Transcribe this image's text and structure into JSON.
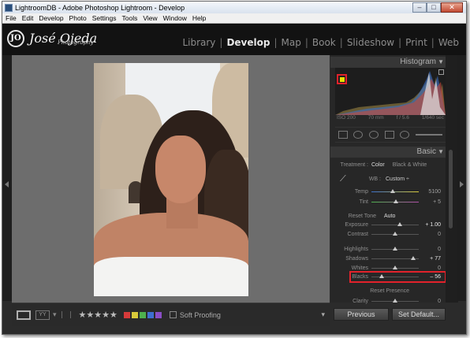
{
  "window": {
    "title": "LightroomDB - Adobe Photoshop Lightroom - Develop",
    "minimize": "–",
    "maximize": "□",
    "close": "✕"
  },
  "menu": [
    "File",
    "Edit",
    "Develop",
    "Photo",
    "Settings",
    "Tools",
    "View",
    "Window",
    "Help"
  ],
  "identity": {
    "initials": "JO",
    "name": "José Ojeda",
    "sub": "Photography"
  },
  "modules": [
    {
      "label": "Library",
      "active": false
    },
    {
      "label": "Develop",
      "active": true
    },
    {
      "label": "Map",
      "active": false
    },
    {
      "label": "Book",
      "active": false
    },
    {
      "label": "Slideshow",
      "active": false
    },
    {
      "label": "Print",
      "active": false
    },
    {
      "label": "Web",
      "active": false
    }
  ],
  "histogram": {
    "title": "Histogram",
    "iso": "ISO 200",
    "focal": "70 mm",
    "aperture": "f / 5.6",
    "shutter": "1/640 sec"
  },
  "basic": {
    "title": "Basic",
    "treatment_label": "Treatment :",
    "treatment_color": "Color",
    "treatment_bw": "Black & White",
    "wb_label": "WB :",
    "wb_value": "Custom ÷",
    "reset_tone": "Reset Tone",
    "auto": "Auto",
    "reset_presence": "Reset Presence",
    "sliders": [
      {
        "label": "Temp",
        "value": "5100",
        "pos": 0.45
      },
      {
        "label": "Tint",
        "value": "+ 5",
        "pos": 0.52
      },
      {
        "label": "Exposure",
        "value": "+ 1.00",
        "pos": 0.6
      },
      {
        "label": "Contrast",
        "value": "0",
        "pos": 0.5
      },
      {
        "label": "Highlights",
        "value": "0",
        "pos": 0.5
      },
      {
        "label": "Shadows",
        "value": "+ 77",
        "pos": 0.88
      },
      {
        "label": "Whites",
        "value": "0",
        "pos": 0.5
      },
      {
        "label": "Blacks",
        "value": "– 56",
        "pos": 0.22
      },
      {
        "label": "Clarity",
        "value": "0",
        "pos": 0.5
      }
    ]
  },
  "filmstrip": {
    "soft_proofing": "Soft Proofing",
    "stars": "★★★★★",
    "view_grid_label": "YY"
  },
  "colors": {
    "accent_highlight": "#e2222b",
    "clip_warning": "#e7e000"
  },
  "buttons": {
    "previous": "Previous",
    "set_default": "Set Default..."
  }
}
